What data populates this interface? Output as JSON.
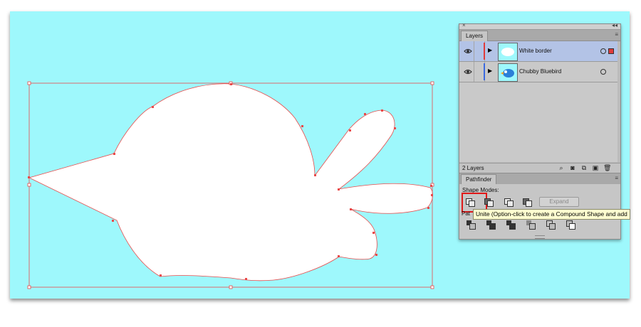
{
  "layers_panel": {
    "tab_label": "Layers",
    "close_glyph": "×",
    "collapse_glyph": "◂◂",
    "menu_glyph": "≡",
    "rows": [
      {
        "name": "White border",
        "selected": true,
        "color": "#e03a3a"
      },
      {
        "name": "Chubby Bluebird",
        "selected": false,
        "color": "#3a6ae0"
      }
    ],
    "footer_count": "2 Layers",
    "footer_icons": [
      "search-icon",
      "make-clipping-mask-icon",
      "create-sublayer-icon",
      "new-layer-icon",
      "delete-layer-icon"
    ]
  },
  "pathfinder_panel": {
    "tab_label": "Pathfinder",
    "shape_modes_label": "Shape Modes:",
    "expand_label": "Expand",
    "pathfinders_label_partial": "Pat",
    "shape_mode_icons": [
      "unite-icon",
      "minus-front-icon",
      "intersect-icon",
      "exclude-icon"
    ],
    "pathfinder_icons": [
      "divide-icon",
      "trim-icon",
      "merge-icon",
      "crop-icon",
      "outline-icon",
      "minus-back-icon"
    ]
  },
  "tooltip": {
    "text": "Unite (Option-click to create a Compound Shape and add"
  },
  "colors": {
    "artboard": "#9ef8fc",
    "selection": "#e84a4a",
    "shape_fill": "#ffffff"
  }
}
